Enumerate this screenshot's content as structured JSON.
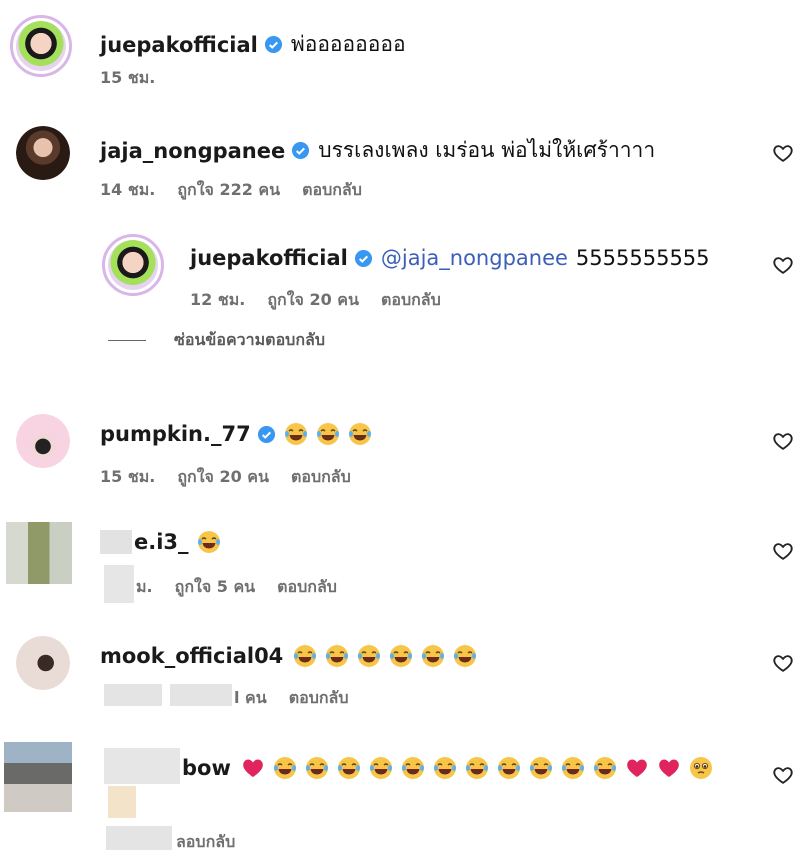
{
  "comments": [
    {
      "username": "juepakofficial",
      "text": "พ่ออออออออ",
      "time": "15 ชม.",
      "likes": "",
      "reply": ""
    },
    {
      "username": "jaja_nongpanee",
      "text": "บรรเลงเพลง เมร่อน พ่อไม่ให้เศร้าาาา",
      "time": "14 ชม.",
      "likes": "ถูกใจ 222 คน",
      "reply": "ตอบกลับ"
    },
    {
      "username": "juepakofficial",
      "mention": "@jaja_nongpanee",
      "text": "5555555555",
      "time": "12 ชม.",
      "likes": "ถูกใจ 20 คน",
      "reply": "ตอบกลับ"
    },
    {
      "username": "pumpkin._77",
      "time": "15 ชม.",
      "likes": "ถูกใจ 20 คน",
      "reply": "ตอบกลับ"
    },
    {
      "username": "e.i3_",
      "time": "ม.",
      "likes": "ถูกใจ 5 คน",
      "reply": "ตอบกลับ"
    },
    {
      "username": "mook_official04",
      "time": "",
      "likes": "l คน",
      "reply": "ตอบกลับ"
    },
    {
      "username": "bow",
      "time": "",
      "likes": "",
      "reply": "ลอบกลับ"
    }
  ],
  "hide_replies": "ซ่อนข้อความตอบกลับ",
  "colors": {
    "verified": "#3897f0",
    "mention": "#3b5fb8",
    "meta": "#6f6f6f",
    "emoji": "#f7c548",
    "heart_red": "#e0245e"
  },
  "icons": {
    "verified": "verified-badge-icon",
    "like": "heart-outline-icon",
    "emoji": "laughing-tears-emoji"
  }
}
